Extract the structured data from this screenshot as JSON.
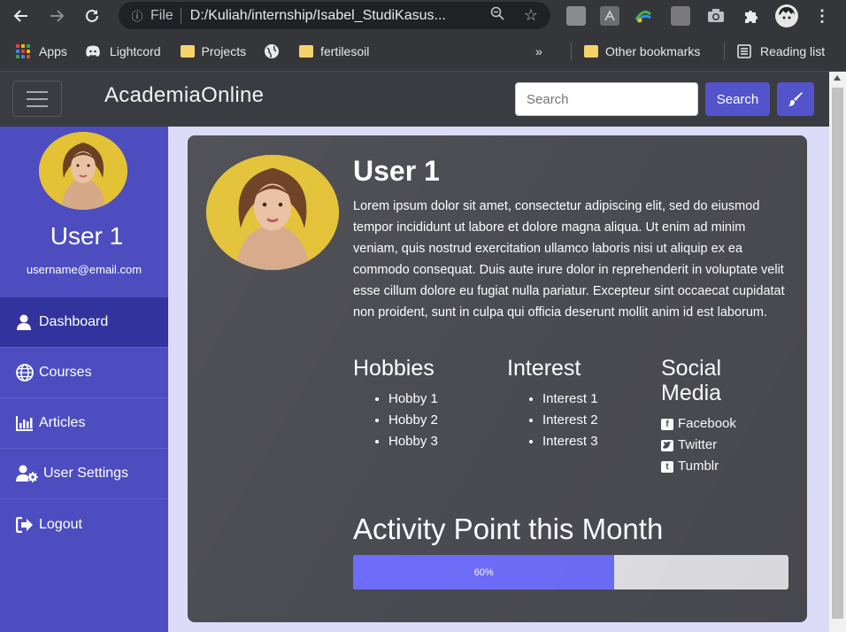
{
  "browser": {
    "url_prefix": "File",
    "url": "D:/Kuliah/internship/Isabel_StudiKasus...",
    "bookmarks": [
      "Apps",
      "Lightcord",
      "Projects",
      "fertilesoil"
    ],
    "overflow": "»",
    "other_bookmarks": "Other bookmarks",
    "reading_list": "Reading list"
  },
  "navbar": {
    "brand": "AcademiaOnline",
    "search_placeholder": "Search",
    "search_button": "Search"
  },
  "sidebar": {
    "name": "User 1",
    "email": "username@email.com",
    "items": [
      {
        "label": "Dashboard",
        "icon": "user-icon",
        "active": true
      },
      {
        "label": "Courses",
        "icon": "globe-icon"
      },
      {
        "label": "Articles",
        "icon": "bar-chart-icon"
      },
      {
        "label": "User Settings",
        "icon": "user-cog-icon"
      },
      {
        "label": "Logout",
        "icon": "sign-out-icon"
      }
    ]
  },
  "profile": {
    "name": "User 1",
    "bio": "Lorem ipsum dolor sit amet, consectetur adipiscing elit, sed do eiusmod tempor incididunt ut labore et dolore magna aliqua. Ut enim ad minim veniam, quis nostrud exercitation ullamco laboris nisi ut aliquip ex ea commodo consequat. Duis aute irure dolor in reprehenderit in voluptate velit esse cillum dolore eu fugiat nulla pariatur. Excepteur sint occaecat cupidatat non proident, sunt in culpa qui officia deserunt mollit anim id est laborum.",
    "hobbies_title": "Hobbies",
    "hobbies": [
      "Hobby 1",
      "Hobby 2",
      "Hobby 3"
    ],
    "interest_title": "Interest",
    "interests": [
      "Interest 1",
      "Interest 2",
      "Interest 3"
    ],
    "social_title": "Social Media",
    "social": [
      "Facebook",
      "Twitter",
      "Tumblr"
    ],
    "activity_title": "Activity Point this Month",
    "activity_percent": 60,
    "activity_label": "60%"
  },
  "colors": {
    "accent": "#5353cc",
    "sidebar": "#4d4dc0",
    "sidebar_active": "#33339e",
    "card": "#4b4b52",
    "progress_fill": "#6d6dfa"
  }
}
